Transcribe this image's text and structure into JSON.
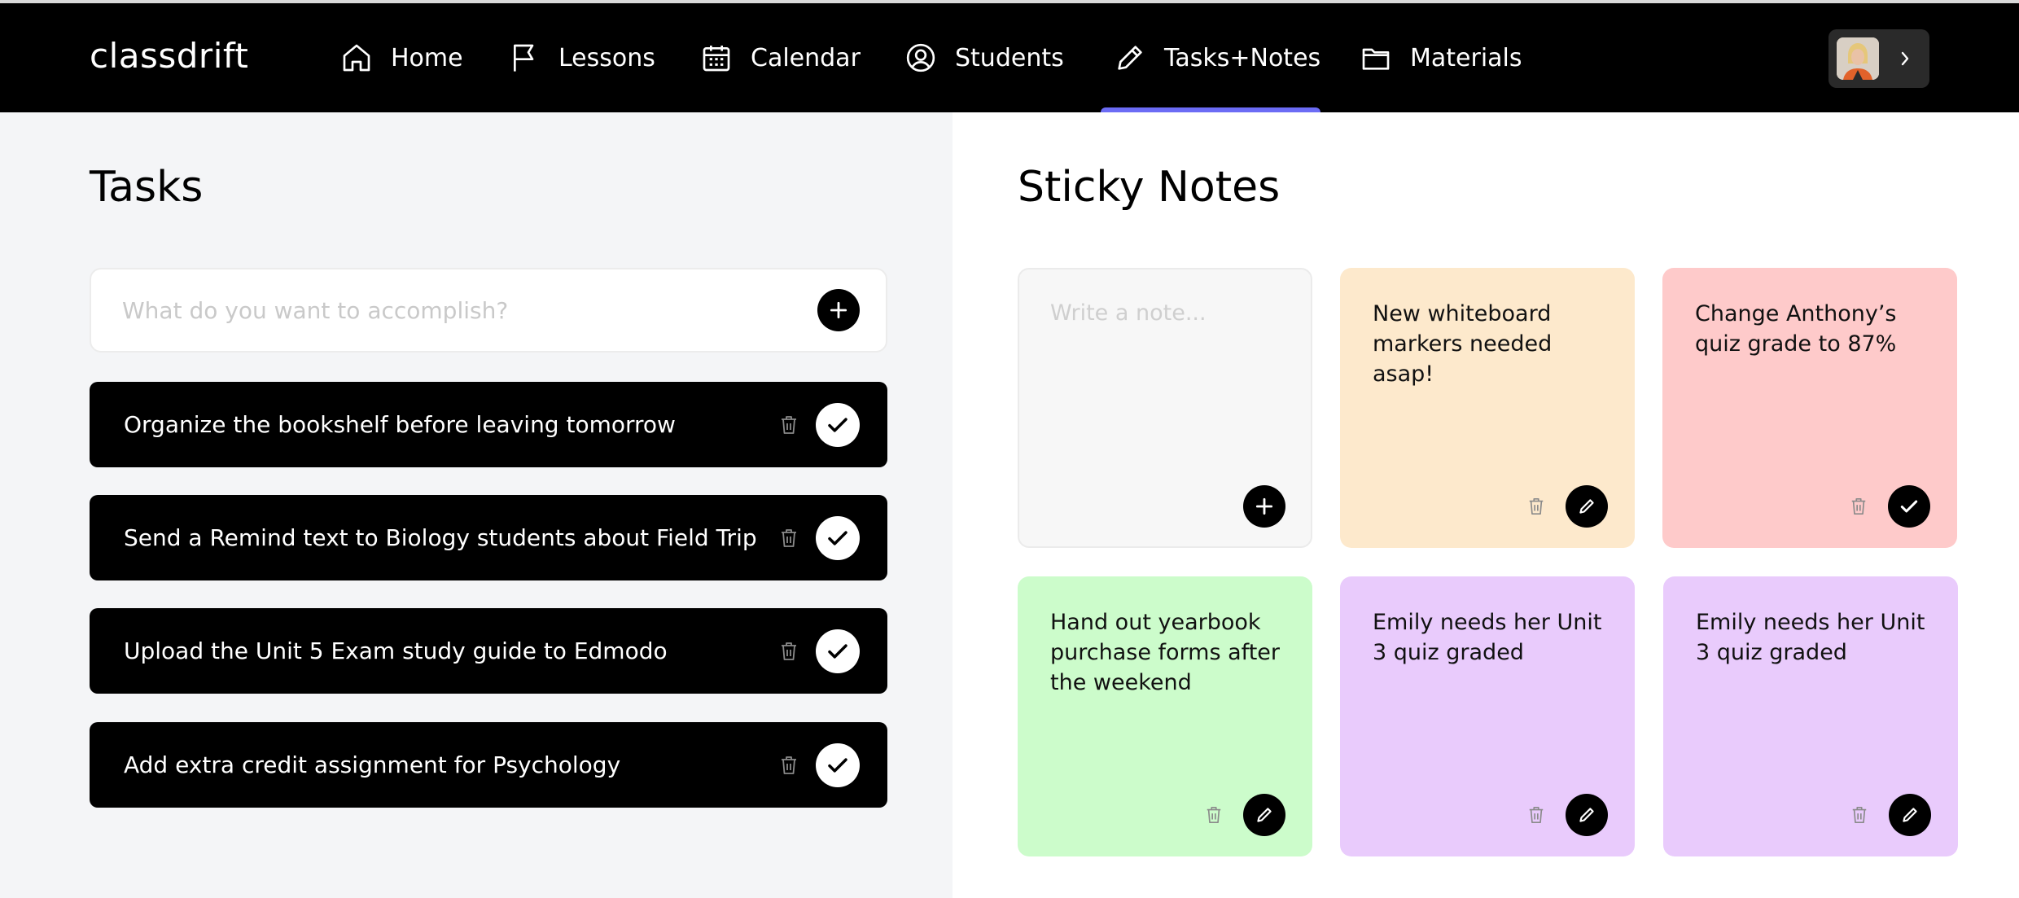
{
  "app": {
    "logo": "classdrift"
  },
  "nav": {
    "items": [
      {
        "label": "Home",
        "icon": "home-icon"
      },
      {
        "label": "Lessons",
        "icon": "flag-icon"
      },
      {
        "label": "Calendar",
        "icon": "calendar-icon"
      },
      {
        "label": "Students",
        "icon": "user-circle-icon"
      },
      {
        "label": "Tasks+Notes",
        "icon": "pencil-icon",
        "active": true
      },
      {
        "label": "Materials",
        "icon": "folder-icon"
      }
    ],
    "active_color": "#6c6cf5"
  },
  "tasks": {
    "title": "Tasks",
    "input_placeholder": "What do you want to accomplish?",
    "items": [
      {
        "text": "Organize the bookshelf before leaving tomorrow"
      },
      {
        "text": "Send a Remind text to Biology students about Field Trip"
      },
      {
        "text": "Upload the Unit 5 Exam study guide to Edmodo"
      },
      {
        "text": "Add extra credit assignment for Psychology"
      }
    ]
  },
  "notes": {
    "title": "Sticky Notes",
    "input_placeholder": "Write a note...",
    "input_color": "#f7f7f7",
    "items": [
      {
        "text": "New whiteboard markers needed asap!",
        "color": "#fde9cc",
        "action": "edit"
      },
      {
        "text": "Change Anthony’s quiz grade to 87%",
        "color": "#fecaca",
        "action": "check"
      },
      {
        "text": "Hand out yearbook purchase forms after the weekend",
        "color": "#ccfccb",
        "action": "edit"
      },
      {
        "text": "Emily needs her Unit 3 quiz graded",
        "color": "#e9cbfc",
        "action": "edit"
      },
      {
        "text": "Emily needs her Unit 3 quiz graded",
        "color": "#e9cbfc",
        "action": "edit"
      }
    ]
  }
}
